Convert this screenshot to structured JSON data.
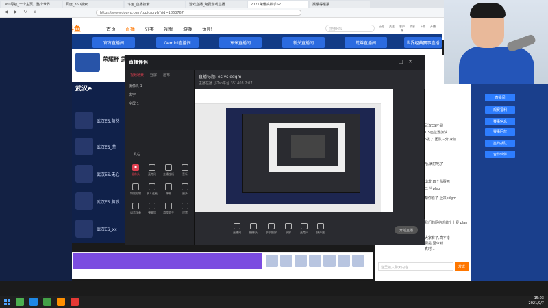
{
  "browser": {
    "tabs": [
      "360导航_一个主页，整个世界",
      "百度_360搜索",
      "斗鱼_直播搜索",
      "游戏直播_免费游戏直播",
      "2021荣耀高校季S2",
      "猴猴得猴猴"
    ],
    "url": "https://www.douyu.com/topic/qryb?rid=1863767",
    "active_tab_index": 4
  },
  "douyu": {
    "logo": "斗鱼",
    "nav": [
      "首页",
      "直播",
      "分类",
      "视频",
      "游戏",
      "鱼吧"
    ],
    "active_nav": "直播",
    "search_placeholder": "搜索KPL",
    "header_icons": [
      "历史",
      "关注",
      "客户端",
      "消息",
      "下载",
      "开播"
    ],
    "category_buttons": [
      "官方直播间",
      "Gemini直播间",
      "东米直播间",
      "新关直播间",
      "荒尊直播间",
      "世界经典赛事直播"
    ],
    "anchor_name": "荣耀杯 武汉",
    "team_banner": "武汉e",
    "side_list": [
      "武汉ES.防然",
      "武汉ES_荒",
      "武汉ES.无心",
      "武汉ES.脑浪",
      "武汉ES_xx"
    ]
  },
  "app": {
    "logo": "直播伴侣",
    "scene_tabs": [
      "视频场景",
      "竖屏",
      "画布"
    ],
    "scene_items": [
      "摄像头 1",
      "文字",
      "全屏 1"
    ],
    "live_title": "直播标题: es vs edgm",
    "live_meta": "主播在播  小Tan平台  351403  2:07",
    "tools_title": "工具栏",
    "tools": [
      "摄像头",
      "麦克风",
      "主播连线",
      "音乐",
      "特效礼物",
      "多人连麦",
      "弹幕",
      "更多",
      "语音伴奏",
      "弹幕墙",
      "游戏助手",
      "设置"
    ],
    "bottom_tools": [
      "直播间",
      "摄像头",
      "手机投屏",
      "录屏",
      "麦克风",
      "扬声器"
    ],
    "start_button": "开始直播"
  },
  "right": {
    "side_buttons": [
      "直播间",
      "观赛福利",
      "赛事信息",
      "赛事回放",
      "签约战队",
      "合作伙伴"
    ],
    "chat_lines": [
      "武汉ES才是",
      "1.5座位置加油",
      "5发了 团队三分 家加",
      "哈,满好吃了",
      "出发,四个队赛吧",
      "二 当pleo",
      "帮你看了 上来edgm",
      "我们的网络想做个上赛 plan",
      "大家有了,真不错",
      "要是,至今就",
      "真时..."
    ],
    "chat_placeholder": "这里输入聊天内容",
    "send_label": "发送"
  },
  "taskbar": {
    "time": "15:03",
    "date": "2021/9/7"
  }
}
